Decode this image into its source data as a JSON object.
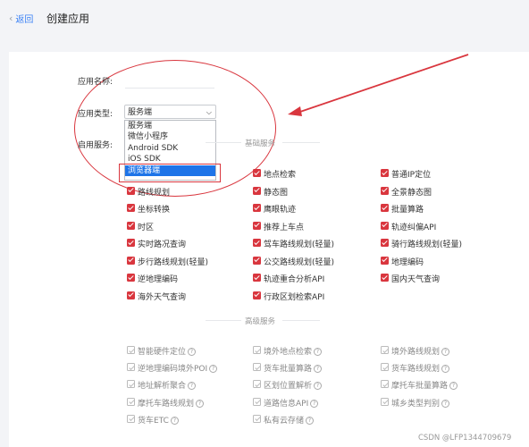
{
  "header": {
    "back_label": "返回",
    "title": "创建应用"
  },
  "form": {
    "name_label": "应用名称:",
    "type_label": "应用类型:",
    "services_label": "启用服务:",
    "type_selected": "服务端",
    "type_options": [
      "服务端",
      "微信小程序",
      "Android SDK",
      "iOS SDK",
      "浏览器端"
    ],
    "type_highlighted": "浏览器端"
  },
  "basic": {
    "title": "基础服务",
    "items": [
      {
        "label": "地点检索",
        "checked": true
      },
      {
        "label": "普通IP定位",
        "checked": true
      },
      {
        "label": "路线规划",
        "checked": true
      },
      {
        "label": "静态图",
        "checked": true
      },
      {
        "label": "全景静态图",
        "checked": true
      },
      {
        "label": "坐标转换",
        "checked": true
      },
      {
        "label": "鹰眼轨迹",
        "checked": true
      },
      {
        "label": "批量算路",
        "checked": true
      },
      {
        "label": "时区",
        "checked": true
      },
      {
        "label": "推荐上车点",
        "checked": true
      },
      {
        "label": "轨迹纠偏API",
        "checked": true
      },
      {
        "label": "实时路况查询",
        "checked": true
      },
      {
        "label": "驾车路线规划(轻量)",
        "checked": true
      },
      {
        "label": "骑行路线规划(轻量)",
        "checked": true
      },
      {
        "label": "步行路线规划(轻量)",
        "checked": true
      },
      {
        "label": "公交路线规划(轻量)",
        "checked": true
      },
      {
        "label": "地理编码",
        "checked": true
      },
      {
        "label": "逆地理编码",
        "checked": true
      },
      {
        "label": "轨迹重合分析API",
        "checked": true
      },
      {
        "label": "国内天气查询",
        "checked": true
      },
      {
        "label": "海外天气查询",
        "checked": true
      },
      {
        "label": "行政区划检索API",
        "checked": true
      }
    ]
  },
  "advanced": {
    "title": "高级服务",
    "items": [
      {
        "label": "智能硬件定位"
      },
      {
        "label": "境外地点检索"
      },
      {
        "label": "境外路线规划"
      },
      {
        "label": "逆地理编码境外POI"
      },
      {
        "label": "货车批量算路"
      },
      {
        "label": "货车路线规划"
      },
      {
        "label": "地址解析聚合"
      },
      {
        "label": "区划位置解析"
      },
      {
        "label": "摩托车批量算路"
      },
      {
        "label": "摩托车路线规划"
      },
      {
        "label": "道路信息API"
      },
      {
        "label": "城乡类型判别"
      },
      {
        "label": "货车ETC"
      },
      {
        "label": "私有云存储"
      }
    ],
    "help_glyph": "?"
  },
  "watermark": "CSDN @LFP1344709679",
  "colors": {
    "accent": "#d9363e",
    "select_highlight": "#1e74e8",
    "link": "#3b82f6"
  }
}
